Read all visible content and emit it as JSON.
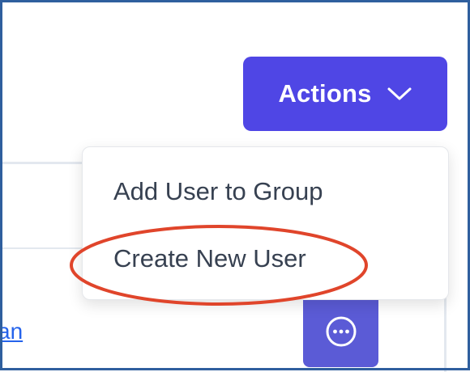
{
  "actions_button": {
    "label": "Actions",
    "icon": "chevron-down-icon",
    "color": "#4f46e5"
  },
  "dropdown": {
    "items": [
      {
        "label": "Add User to Group"
      },
      {
        "label": "Create New User"
      }
    ]
  },
  "background": {
    "link_text": "an",
    "more_button_icon": "more-horizontal-icon",
    "more_button_color": "#5b5bd6"
  },
  "annotation": {
    "highlight_color": "#e0452b",
    "target": "Create New User"
  },
  "frame": {
    "border_color": "#2f5f9e"
  }
}
